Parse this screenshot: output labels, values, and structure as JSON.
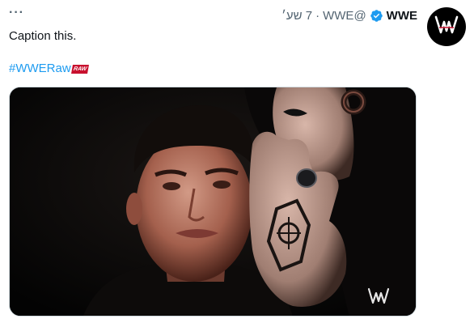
{
  "header": {
    "author_name": "WWE",
    "handle": "@WWE",
    "separator": "·",
    "time": "7 שע׳",
    "verified_icon": "verified-badge-icon",
    "more_icon": "more-horizontal-icon",
    "more_glyph": "···"
  },
  "avatar": {
    "icon": "wwe-logo-icon"
  },
  "tweet": {
    "text": "Caption this.",
    "hashtag": "#WWERaw",
    "hashtag_emoji_text": "RAW"
  },
  "media": {
    "description_icon": "photo",
    "watermark_icon": "wwe-logo-icon"
  },
  "colors": {
    "link": "#1d9bf0",
    "muted": "#536471",
    "text": "#0f1419",
    "verified": "#1d9bf0",
    "raw_red": "#c8102e"
  }
}
